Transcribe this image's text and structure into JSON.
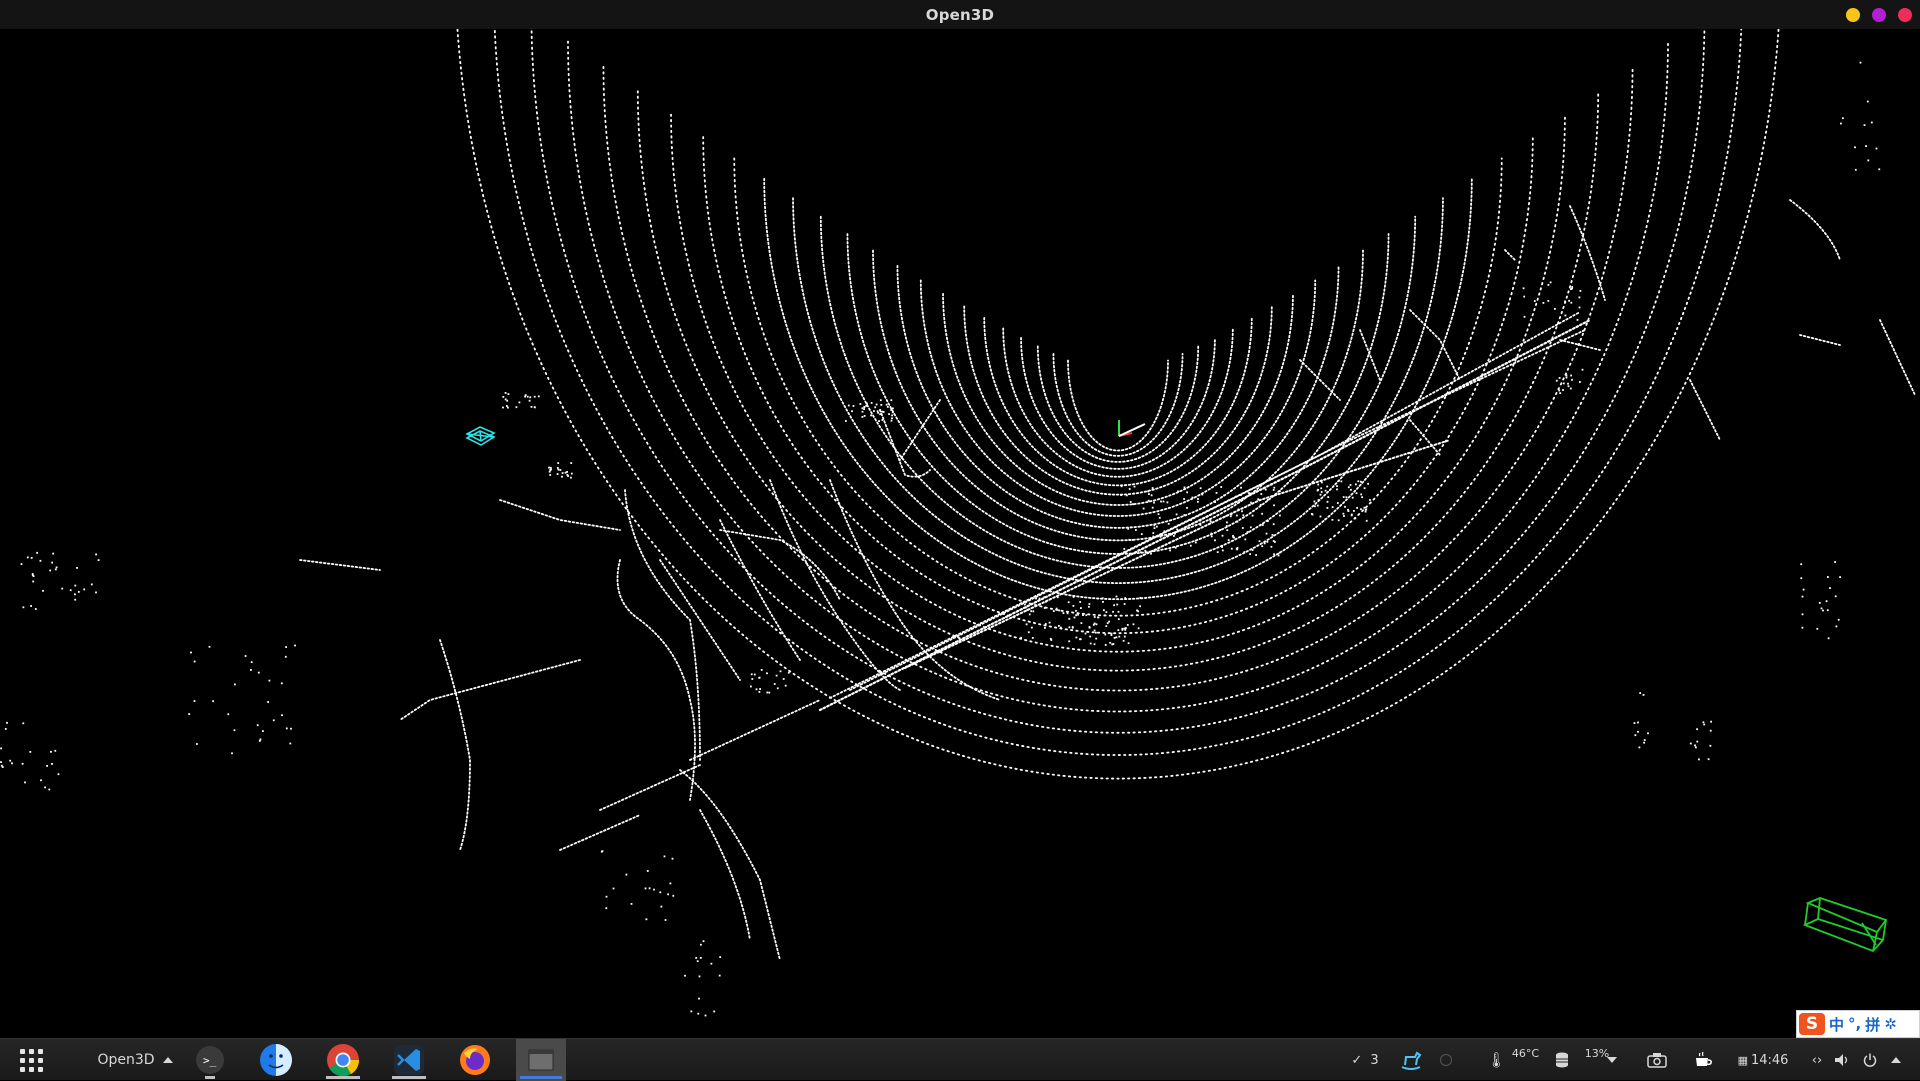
{
  "window": {
    "title": "Open3D",
    "controls": {
      "minimize_color": "#f5c518",
      "maximize_color": "#b41fd6",
      "close_color": "#ef2d5a"
    }
  },
  "viewport": {
    "background": "#000000",
    "points_color": "#ffffff",
    "cyan_box_color": "#2de3e8",
    "green_box_color": "#1fcc2a",
    "axis_colors": [
      "#ff3a3a",
      "#2ee04a",
      "#3a6bff"
    ]
  },
  "ime": {
    "logo": "S",
    "mode": "中",
    "punct": "°,",
    "pinyin": "拼",
    "settings_icon": "gear-icon"
  },
  "taskbar": {
    "launcher_icon": "app-grid-icon",
    "active_app_label": "Open3D",
    "apps": [
      {
        "name": "terminal",
        "icon": "terminal-icon",
        "label": ">_"
      },
      {
        "name": "finder",
        "icon": "finder-face-icon"
      },
      {
        "name": "chrome",
        "icon": "chrome-icon"
      },
      {
        "name": "vscode",
        "icon": "vscode-icon"
      },
      {
        "name": "firefox",
        "icon": "firefox-icon"
      },
      {
        "name": "open3d-window",
        "icon": "window-icon"
      }
    ],
    "tray": {
      "tasks_count": "3",
      "temperature": "46°C",
      "disk_usage": "13%",
      "clock": "14:46"
    }
  }
}
